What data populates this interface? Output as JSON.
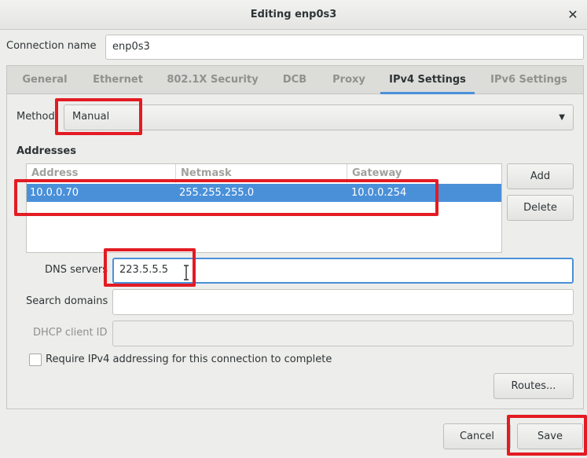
{
  "window": {
    "title": "Editing enp0s3"
  },
  "connection": {
    "label": "Connection name",
    "value": "enp0s3"
  },
  "tabs": [
    {
      "label": "General"
    },
    {
      "label": "Ethernet"
    },
    {
      "label": "802.1X Security"
    },
    {
      "label": "DCB"
    },
    {
      "label": "Proxy"
    },
    {
      "label": "IPv4 Settings"
    },
    {
      "label": "IPv6 Settings"
    }
  ],
  "active_tab": "IPv4 Settings",
  "method": {
    "label": "Method",
    "value": "Manual"
  },
  "addresses": {
    "title": "Addresses",
    "columns": [
      "Address",
      "Netmask",
      "Gateway"
    ],
    "rows": [
      {
        "address": "10.0.0.70",
        "netmask": "255.255.255.0",
        "gateway": "10.0.0.254"
      }
    ],
    "add_label": "Add",
    "delete_label": "Delete"
  },
  "dns": {
    "label": "DNS servers",
    "value": "223.5.5.5"
  },
  "search_domains": {
    "label": "Search domains",
    "value": ""
  },
  "dhcp_client_id": {
    "label": "DHCP client ID",
    "value": ""
  },
  "require_ipv4": {
    "label": "Require IPv4 addressing for this connection to complete",
    "checked": false
  },
  "routes_label": "Routes...",
  "actions": {
    "cancel_label": "Cancel",
    "save_label": "Save"
  },
  "colors": {
    "accent": "#4a90d9",
    "highlight": "#e31b23"
  }
}
